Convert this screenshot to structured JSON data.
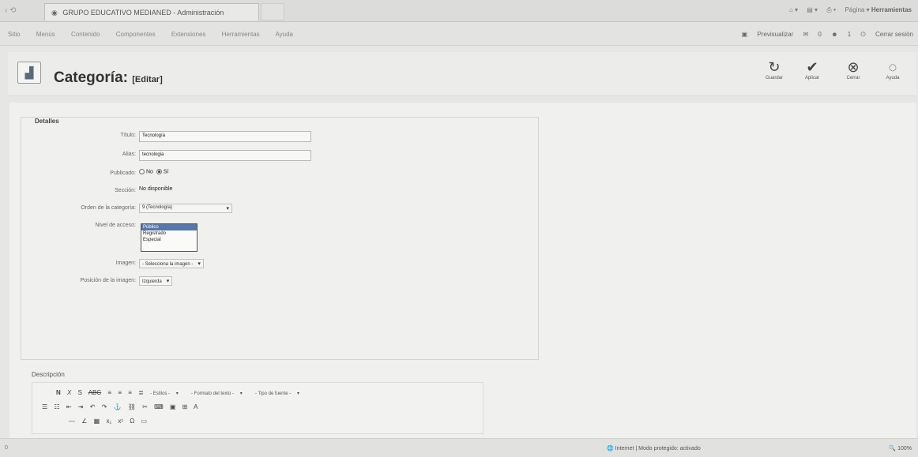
{
  "browser": {
    "nav_arrows": "‹ ⟲",
    "tab_title": "GRUPO EDUCATIVO MEDIANED - Administración",
    "tools": [
      "Página ▾",
      "Herramientas"
    ]
  },
  "menu": {
    "items": [
      "Sitio",
      "Menús",
      "Contenido",
      "Componentes",
      "Extensiones",
      "Herramientas",
      "Ayuda"
    ],
    "status": [
      "Previsualizar",
      "0",
      "1",
      "Cerrar sesión"
    ]
  },
  "header": {
    "title": "Categoría:",
    "subtitle": "[Editar]"
  },
  "toolbar": {
    "buttons": [
      {
        "label": "Guardar",
        "icon": "save-icon"
      },
      {
        "label": "Aplicar",
        "icon": "apply-icon"
      },
      {
        "label": "Cerrar",
        "icon": "close-icon"
      },
      {
        "label": "Ayuda",
        "icon": "help-icon"
      }
    ]
  },
  "details": {
    "legend": "Detalles",
    "title_label": "Título:",
    "title_value": "Tecnología",
    "alias_label": "Alias:",
    "alias_value": "tecnologia",
    "published_label": "Publicado:",
    "published_no": "No",
    "published_yes": "Sí",
    "section_label": "Sección:",
    "section_value": "No disponible",
    "order_label": "Orden de la categoría:",
    "order_value": "9 (Tecnología)",
    "access_label": "Nivel de acceso:",
    "access_options": [
      "Público",
      "Registrado",
      "Especial"
    ],
    "image_label": "Imagen:",
    "image_value": "- Selecciona la imagen -",
    "image_pos_label": "Posición de la imagen:",
    "image_pos_value": "Izquierda"
  },
  "description": {
    "legend": "Descripción",
    "styles": "- Estilos -",
    "format": "- Formato del texto -",
    "font": "- Tipo de fuente -"
  },
  "statusbar": {
    "left": "0",
    "zone": "Internet | Modo protegido: activado",
    "zoom": "100%"
  }
}
